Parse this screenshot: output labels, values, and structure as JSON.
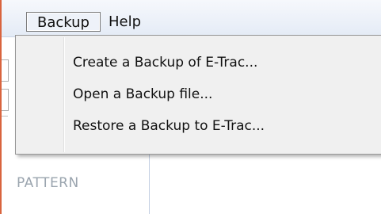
{
  "menubar": {
    "items": [
      {
        "label": "Backup"
      },
      {
        "label": "Help"
      }
    ]
  },
  "dropdown": {
    "items": [
      {
        "label": "Create a Backup of E-Trac..."
      },
      {
        "label": "Open a Backup file..."
      },
      {
        "label": "Restore a Backup to E-Trac..."
      }
    ]
  },
  "background": {
    "pattern_label": "PATTERN"
  },
  "colors": {
    "frame_accent": "#d9643e",
    "menubar_top": "#f6f8fc",
    "menubar_bottom": "#e4ebf6",
    "dropdown_bg": "#f0f0f0",
    "faded_text": "#9aa4ae"
  }
}
